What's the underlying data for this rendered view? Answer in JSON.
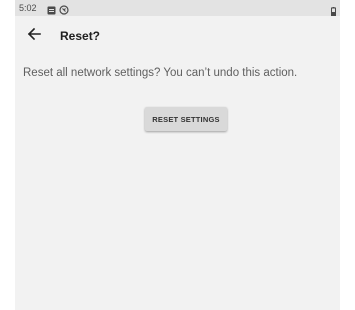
{
  "status_bar": {
    "time": "5:02",
    "icons": [
      "notification-icon",
      "vpn-icon",
      "battery-icon"
    ]
  },
  "app_bar": {
    "back_icon": "arrow-left-icon",
    "title": "Reset?"
  },
  "content": {
    "message": "Reset all network settings? You can’t undo this action.",
    "reset_button_label": "RESET SETTINGS"
  },
  "colors": {
    "screen_background": "#f2f2f2",
    "status_bar_background": "#e3e3e3",
    "button_background": "#d9d9d9",
    "title_text": "#202020",
    "message_text": "#5f5f5f"
  }
}
